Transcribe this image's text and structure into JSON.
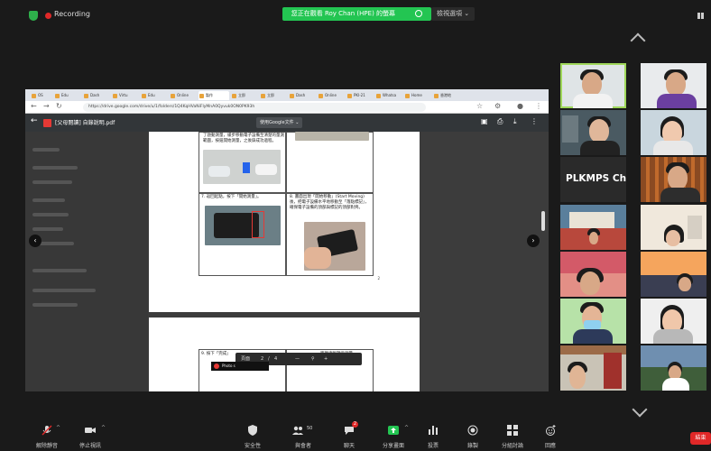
{
  "meeting": {
    "recording_label": "Recording",
    "share_banner": "您正在觀看 Roy Chan (HPE) 的螢幕",
    "view_options": "檢視選項 ⌄"
  },
  "browser": {
    "tabs": [
      "OS",
      "Edu",
      "Dash",
      "Virtu",
      "Edu",
      "Online",
      "製作",
      "立即",
      "立即",
      "Dash",
      "Online",
      "PKI-21",
      "Whatsa",
      "Home",
      "香港地"
    ],
    "url": "https://drive.google.com/drive/u/1/folders/1Q4KqHVaNiFlyMnA0Qyvuk0ON0PK93h"
  },
  "pdf": {
    "file_name": "[父母閱讀] 自錄說明.pdf",
    "open_with": "使用Google文件 ⌄",
    "step7_text": "7.  返回起點，按下「開始測量」。",
    "step8_text": "8.  畫面出現「開始移動」(Start Moving)後，把電子設備水平地移動至「落點標記」，確保電子設備的頂部與標記的頂部對齊。",
    "top_text": "了啟動測量，緩步移動電子設備至清楚的量測範圍，按鈕開始測量，之後錄成功過程。",
    "page_number": "2",
    "step9_text": "9.  按下「完成」",
    "step9_rest": "距離清晰顯示測量",
    "zoom_page": "頁面",
    "zoom_index": "2",
    "zoom_sep": "/",
    "zoom_total": "4",
    "toast_text": "Photo s"
  },
  "gallery": {
    "name_tile": "PLKMPS Cha..."
  },
  "toolbar": {
    "unmute": "解除靜音",
    "stop_video": "停止視訊",
    "security": "安全性",
    "participants": "與會者",
    "participants_count": "50",
    "chat": "聊天",
    "chat_badge": "2",
    "share_screen": "分享畫面",
    "polls": "投票",
    "record": "錄製",
    "breakout": "分組討論",
    "reactions": "回應",
    "end": "結束"
  },
  "colors": {
    "share_green": "#23c552",
    "record_red": "#e02828",
    "speaking_outline": "#9fd75a"
  }
}
